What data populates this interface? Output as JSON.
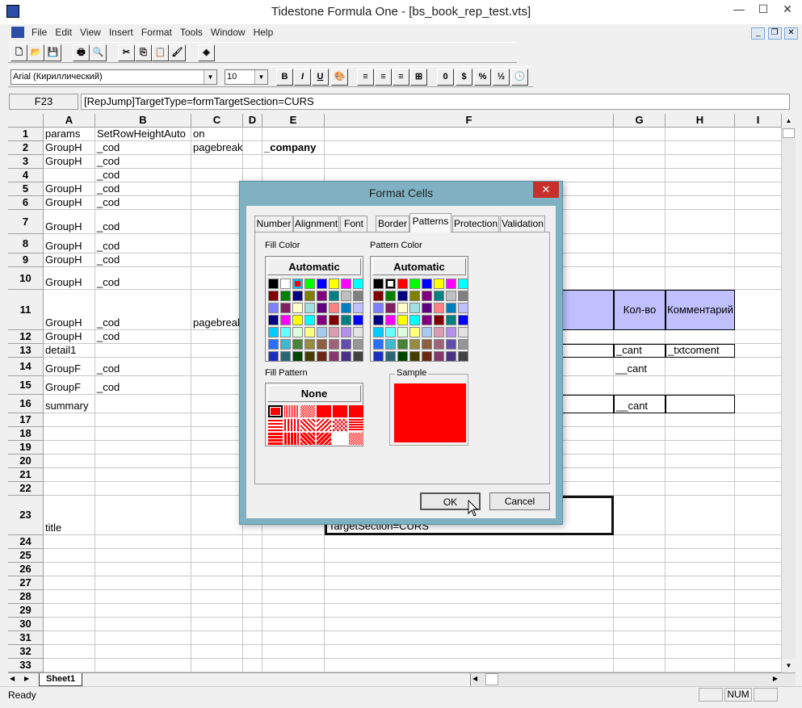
{
  "window": {
    "title": "Tidestone Formula One - [bs_book_rep_test.vts]",
    "minimize": "—",
    "maximize": "☐",
    "close": "✕"
  },
  "menu": [
    "File",
    "Edit",
    "View",
    "Insert",
    "Format",
    "Tools",
    "Window",
    "Help"
  ],
  "mdi": {
    "minimize": "_",
    "restore": "❐",
    "close": "✕"
  },
  "toolbar1": [
    {
      "name": "new-icon",
      "g": "🗋"
    },
    {
      "name": "open-icon",
      "g": "📂"
    },
    {
      "name": "save-icon",
      "g": "💾"
    },
    {
      "name": "print-icon",
      "g": "🖶"
    },
    {
      "name": "print-preview-icon",
      "g": "🔍"
    },
    {
      "name": "cut-icon",
      "g": "✂"
    },
    {
      "name": "copy-icon",
      "g": "⎘"
    },
    {
      "name": "paste-icon",
      "g": "📋"
    },
    {
      "name": "format-painter-icon",
      "g": "🖌"
    },
    {
      "name": "object-icon",
      "g": "◈"
    }
  ],
  "font": {
    "name": "Arial (Кириллический)",
    "size": "10"
  },
  "toolbar2": [
    {
      "name": "bold-button",
      "g": "B"
    },
    {
      "name": "italic-button",
      "g": "I"
    },
    {
      "name": "underline-button",
      "g": "U"
    },
    {
      "name": "color-palette-icon",
      "g": "🎨"
    },
    {
      "name": "align-left-icon",
      "g": "≡"
    },
    {
      "name": "align-center-icon",
      "g": "≡"
    },
    {
      "name": "align-right-icon",
      "g": "≡"
    },
    {
      "name": "merge-icon",
      "g": "⊞"
    },
    {
      "name": "number-format-button",
      "g": "0"
    },
    {
      "name": "currency-icon",
      "g": "$"
    },
    {
      "name": "percent-button",
      "g": "%"
    },
    {
      "name": "fraction-button",
      "g": "½"
    },
    {
      "name": "time-icon",
      "g": "🕒"
    }
  ],
  "formula_bar": {
    "cell_ref": "F23",
    "content": "[RepJump]TargetType=formTargetSection=CURS"
  },
  "columns": [
    "A",
    "B",
    "C",
    "D",
    "E",
    "F",
    "G",
    "H",
    "I"
  ],
  "rows": [
    "1",
    "2",
    "3",
    "4",
    "5",
    "6",
    "7",
    "8",
    "9",
    "10",
    "11",
    "12",
    "13",
    "14",
    "15",
    "16",
    "17",
    "18",
    "19",
    "20",
    "21",
    "22",
    "23",
    "24",
    "25",
    "26",
    "27",
    "28",
    "29",
    "30",
    "31",
    "32",
    "33"
  ],
  "cells": [
    {
      "r": 1,
      "c": "A",
      "v": "params"
    },
    {
      "r": 1,
      "c": "B",
      "v": "SetRowHeightAuto"
    },
    {
      "r": 1,
      "c": "C",
      "v": "on"
    },
    {
      "r": 2,
      "c": "A",
      "v": "GroupH"
    },
    {
      "r": 2,
      "c": "B",
      "v": "_cod"
    },
    {
      "r": 2,
      "c": "C",
      "v": "pagebreak"
    },
    {
      "r": 2,
      "c": "E",
      "v": "_company",
      "bold": true
    },
    {
      "r": 3,
      "c": "A",
      "v": "GroupH"
    },
    {
      "r": 3,
      "c": "B",
      "v": "_cod"
    },
    {
      "r": 4,
      "c": "B",
      "v": "_cod"
    },
    {
      "r": 5,
      "c": "A",
      "v": "GroupH"
    },
    {
      "r": 5,
      "c": "B",
      "v": "_cod"
    },
    {
      "r": 6,
      "c": "A",
      "v": "GroupH"
    },
    {
      "r": 6,
      "c": "B",
      "v": "_cod"
    },
    {
      "r": 7,
      "c": "A",
      "v": "GroupH"
    },
    {
      "r": 7,
      "c": "B",
      "v": "_cod"
    },
    {
      "r": 8,
      "c": "A",
      "v": "GroupH"
    },
    {
      "r": 8,
      "c": "B",
      "v": "_cod"
    },
    {
      "r": 9,
      "c": "A",
      "v": "GroupH"
    },
    {
      "r": 9,
      "c": "B",
      "v": "_cod"
    },
    {
      "r": 10,
      "c": "A",
      "v": "GroupH"
    },
    {
      "r": 10,
      "c": "B",
      "v": "_cod"
    },
    {
      "r": 11,
      "c": "A",
      "v": "GroupH"
    },
    {
      "r": 11,
      "c": "B",
      "v": "_cod"
    },
    {
      "r": 11,
      "c": "C",
      "v": "pagebreak"
    },
    {
      "r": 11,
      "c": "F",
      "v": "",
      "fill": "#c0c0ff",
      "box": true
    },
    {
      "r": 11,
      "c": "G",
      "v": "Кол-во",
      "fill": "#c0c0ff",
      "box": true,
      "center": true
    },
    {
      "r": 11,
      "c": "H",
      "v": "Комментарий",
      "fill": "#c0c0ff",
      "box": true,
      "center": true
    },
    {
      "r": 12,
      "c": "A",
      "v": "GroupH"
    },
    {
      "r": 12,
      "c": "B",
      "v": "_cod"
    },
    {
      "r": 13,
      "c": "A",
      "v": "detail1"
    },
    {
      "r": 13,
      "c": "F",
      "v": "",
      "box": true
    },
    {
      "r": 13,
      "c": "G",
      "v": "_cant",
      "box": true
    },
    {
      "r": 13,
      "c": "H",
      "v": "_txtcoment",
      "box": true
    },
    {
      "r": 14,
      "c": "A",
      "v": "GroupF"
    },
    {
      "r": 14,
      "c": "B",
      "v": "_cod"
    },
    {
      "r": 14,
      "c": "G",
      "v": "__cant"
    },
    {
      "r": 15,
      "c": "A",
      "v": "GroupF"
    },
    {
      "r": 15,
      "c": "B",
      "v": "_cod"
    },
    {
      "r": 16,
      "c": "A",
      "v": "summary"
    },
    {
      "r": 16,
      "c": "F",
      "v": "",
      "box": true
    },
    {
      "r": 16,
      "c": "G",
      "v": "__cant",
      "box": true
    },
    {
      "r": 16,
      "c": "H",
      "v": "",
      "box": true
    },
    {
      "r": 23,
      "c": "A",
      "v": "title"
    },
    {
      "r": 23,
      "c": "F",
      "v": "[RepJump]TargetType=form\nTargetSection=CURS",
      "selected": true
    }
  ],
  "sheet_tab": "Sheet1",
  "status": {
    "text": "Ready",
    "num": "NUM"
  },
  "dialog": {
    "title": "Format Cells",
    "tabs": [
      "Number",
      "Alignment",
      "Font",
      "Border",
      "Patterns",
      "Protection",
      "Validation"
    ],
    "active_tab": "Patterns",
    "fill_color_label": "Fill Color",
    "pattern_color_label": "Pattern Color",
    "automatic": "Automatic",
    "fill_pattern_label": "Fill Pattern",
    "none": "None",
    "sample_label": "Sample",
    "sample_color": "#ff0000",
    "selected_fill": "#ff0000",
    "selected_pattern_color": "#ffffff",
    "palette": [
      "#000000",
      "#ffffff",
      "#ff0000",
      "#00ff00",
      "#0000ff",
      "#ffff00",
      "#ff00ff",
      "#00ffff",
      "#800000",
      "#008000",
      "#000080",
      "#808000",
      "#800080",
      "#008080",
      "#c0c0c0",
      "#808080",
      "#8080ff",
      "#802060",
      "#ffffcc",
      "#a0e0e0",
      "#600080",
      "#ff8080",
      "#0080c0",
      "#c0c0ff",
      "#000080",
      "#ff00ff",
      "#ffff00",
      "#00ffff",
      "#800080",
      "#800000",
      "#008080",
      "#0000ff",
      "#00ccff",
      "#66ffff",
      "#ddffdd",
      "#ffff80",
      "#a6caf0",
      "#dd9cb3",
      "#b38fee",
      "#e3e3e3",
      "#2a6ff9",
      "#3fb8cd",
      "#488436",
      "#958c41",
      "#8e5e42",
      "#a0627a",
      "#624fac",
      "#969696",
      "#1d2fbe",
      "#286676",
      "#004500",
      "#453e01",
      "#6a2813",
      "#85396a",
      "#4a3285",
      "#424242"
    ],
    "ok": "OK",
    "cancel": "Cancel"
  }
}
